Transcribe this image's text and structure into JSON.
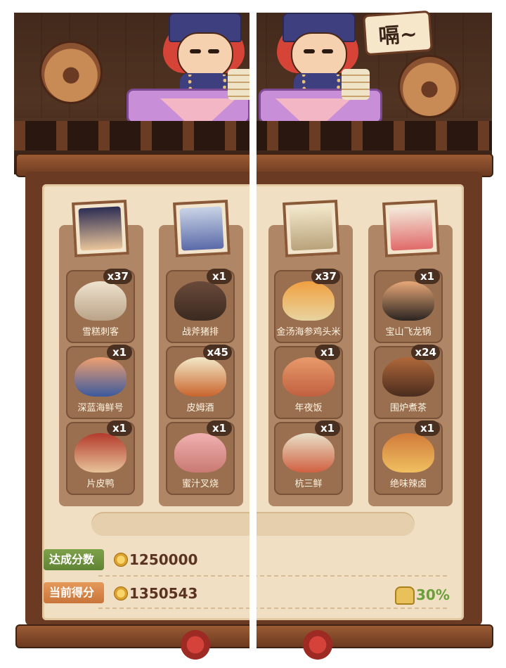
{
  "speech_bubble": "嗝~",
  "left_panel": {
    "characters": [
      {
        "id": "c1"
      },
      {
        "id": "c2"
      }
    ],
    "dishes": [
      {
        "name": "雪糕刺客",
        "qty": "x37"
      },
      {
        "name": "战斧猪排",
        "qty": "x1"
      },
      {
        "name": "深蓝海鲜号",
        "qty": "x1"
      },
      {
        "name": "皮姆酒",
        "qty": "x45"
      },
      {
        "name": "片皮鸭",
        "qty": "x1"
      },
      {
        "name": "蜜汁叉烧",
        "qty": "x1"
      }
    ],
    "target_label": "达成分数",
    "target_score": "1250000",
    "current_label": "当前得分",
    "current_score": "1350543"
  },
  "right_panel": {
    "characters": [
      {
        "id": "c3"
      },
      {
        "id": "c4"
      }
    ],
    "dishes": [
      {
        "name": "金汤海参鸡头米",
        "qty": "x37"
      },
      {
        "name": "宝山飞龙锅",
        "qty": "x1"
      },
      {
        "name": "年夜饭",
        "qty": "x1"
      },
      {
        "name": "围炉煮茶",
        "qty": "x24"
      },
      {
        "name": "杭三鲜",
        "qty": "x1"
      },
      {
        "name": "绝味辣卤",
        "qty": "x1"
      }
    ],
    "percent": "30%"
  },
  "colors": {
    "paper": "#f1dfc3",
    "column": "#b08766",
    "dish_tile": "#9a6f50",
    "green_label": "#6aa03a",
    "orange_label": "#c9743a"
  }
}
